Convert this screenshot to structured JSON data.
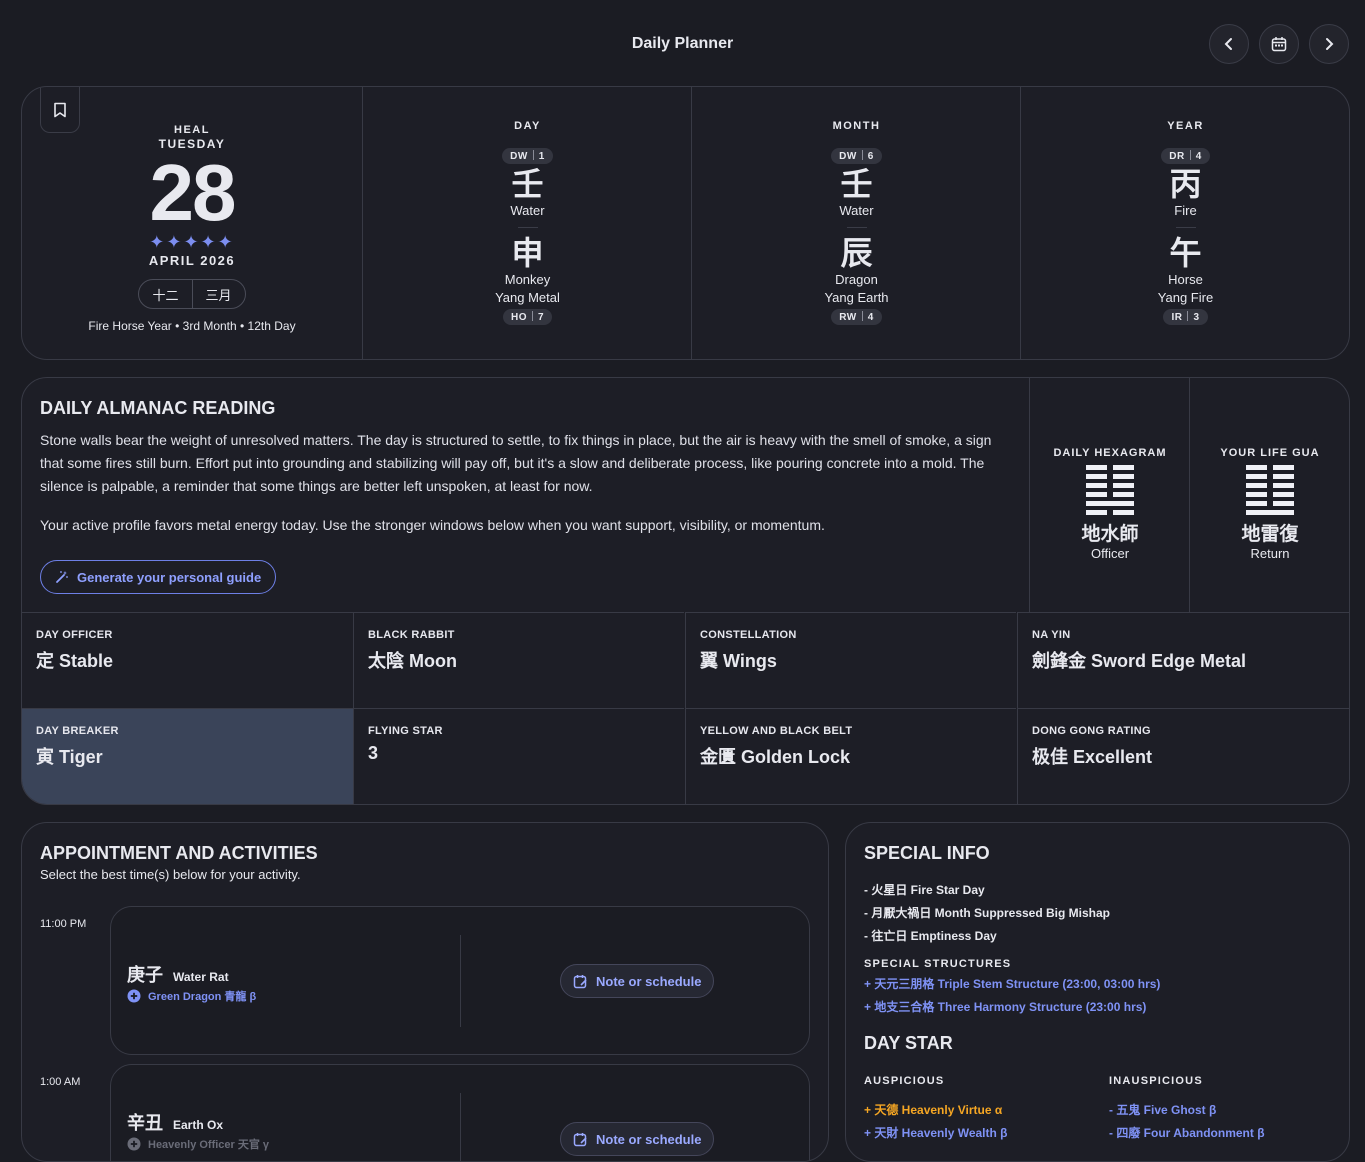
{
  "header": {
    "title": "Daily Planner",
    "prev_icon": "‹",
    "next_icon": "›"
  },
  "date": {
    "weekday_line1": "HEAL",
    "weekday_line2": "TUESDAY",
    "day": "28",
    "stars": "✦✦✦✦✦",
    "rating_stars": 5,
    "month_year": "APRIL 2026",
    "lunar_day": "十二",
    "lunar_month": "三月",
    "summary": "Fire Horse Year • 3rd Month • 12th Day"
  },
  "pillars": [
    {
      "label": "DAY",
      "stem_tag_a": "DW",
      "stem_tag_b": "1",
      "stem": "壬",
      "stem_element": "Water",
      "branch": "申",
      "animal": "Monkey",
      "branch_element": "Yang Metal",
      "branch_tag_a": "HO",
      "branch_tag_b": "7"
    },
    {
      "label": "MONTH",
      "stem_tag_a": "DW",
      "stem_tag_b": "6",
      "stem": "壬",
      "stem_element": "Water",
      "branch": "辰",
      "animal": "Dragon",
      "branch_element": "Yang Earth",
      "branch_tag_a": "RW",
      "branch_tag_b": "4"
    },
    {
      "label": "YEAR",
      "stem_tag_a": "DR",
      "stem_tag_b": "4",
      "stem": "丙",
      "stem_element": "Fire",
      "branch": "午",
      "animal": "Horse",
      "branch_element": "Yang Fire",
      "branch_tag_a": "IR",
      "branch_tag_b": "3"
    }
  ],
  "almanac": {
    "title": "DAILY ALMANAC READING",
    "p1": "Stone walls bear the weight of unresolved matters. The day is structured to settle, to fix things in place, but the air is heavy with the smell of smoke, a sign that some fires still burn. Effort put into grounding and stabilizing will pay off, but it's a slow and deliberate process, like pouring concrete into a mold. The silence is palpable, a reminder that some things are better left unspoken, at least for now.",
    "p2": "Your active profile favors metal energy today. Use the stronger windows below when you want support, visibility, or momentum.",
    "button": "Generate your personal guide",
    "hexagram": {
      "label": "DAILY HEXAGRAM",
      "chars": "地水師",
      "name": "Officer"
    },
    "life_gua": {
      "label": "YOUR LIFE GUA",
      "chars": "地雷復",
      "name": "Return"
    },
    "cells": [
      {
        "label": "DAY OFFICER",
        "value": "定 Stable"
      },
      {
        "label": "BLACK RABBIT",
        "value": "太陰 Moon"
      },
      {
        "label": "CONSTELLATION",
        "value": "翼 Wings"
      },
      {
        "label": "NA YIN",
        "value": "劍鋒金 Sword Edge Metal"
      },
      {
        "label": "DAY BREAKER",
        "value": "寅 Tiger"
      },
      {
        "label": "FLYING STAR",
        "value": "3"
      },
      {
        "label": "YELLOW AND BLACK BELT",
        "value": "金匱 Golden Lock"
      },
      {
        "label": "DONG GONG RATING",
        "value": "极佳 Excellent"
      }
    ]
  },
  "appointments": {
    "title": "APPOINTMENT AND ACTIVITIES",
    "subtitle": "Select the best time(s) below for your activity.",
    "slots": [
      {
        "time": "11:00 PM",
        "chars": "庚子",
        "name": "Water Rat",
        "deity": "Green Dragon 青龍 β",
        "button": "Note or schedule"
      },
      {
        "time": "1:00 AM",
        "chars": "辛丑",
        "name": "Earth Ox",
        "deity": "Heavenly Officer 天官 γ",
        "button": "Note or schedule"
      }
    ]
  },
  "special": {
    "title": "SPECIAL INFO",
    "items": [
      "- 火星日 Fire Star Day",
      "- 月厭大禍日 Month Suppressed Big Mishap",
      "- 往亡日 Emptiness Day"
    ],
    "structures_label": "SPECIAL STRUCTURES",
    "structures": [
      "+ 天元三朋格 Triple Stem Structure (23:00, 03:00 hrs)",
      "+ 地支三合格 Three Harmony Structure (23:00 hrs)"
    ],
    "day_star_title": "DAY STAR",
    "auspicious_label": "AUSPICIOUS",
    "inauspicious_label": "INAUSPICIOUS",
    "auspicious": [
      "+ 天德 Heavenly Virtue α",
      "+ 天財 Heavenly Wealth β"
    ],
    "inauspicious": [
      "- 五鬼 Five Ghost β",
      "- 四廢 Four Abandonment β"
    ]
  },
  "colors": {
    "accent": "#7f92f5",
    "gold": "#f5a623",
    "bg": "#1b1c23",
    "highlight": "#3a4459"
  }
}
